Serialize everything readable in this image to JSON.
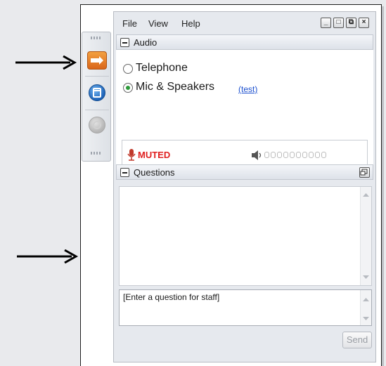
{
  "menu": [
    "File",
    "View",
    "Help"
  ],
  "window_buttons": [
    "_",
    "□",
    "⧉",
    "×"
  ],
  "audio": {
    "header": "Audio",
    "options": [
      "Telephone",
      "Mic & Speakers"
    ],
    "selected": "Mic & Speakers",
    "test_link": "(test)",
    "status": "MUTED",
    "mic_icon": "microphone-icon",
    "speaker_icon": "speaker-icon",
    "level_segments": 10
  },
  "questions": {
    "header": "Questions",
    "input_placeholder": "[Enter a question for staff]",
    "send_label": "Send"
  },
  "colors": {
    "accent_orange": "#e07a25",
    "accent_blue": "#2a6fc4",
    "muted_red": "#e02020",
    "link_blue": "#1b4fcf",
    "selected_green": "#2d9a3a"
  }
}
